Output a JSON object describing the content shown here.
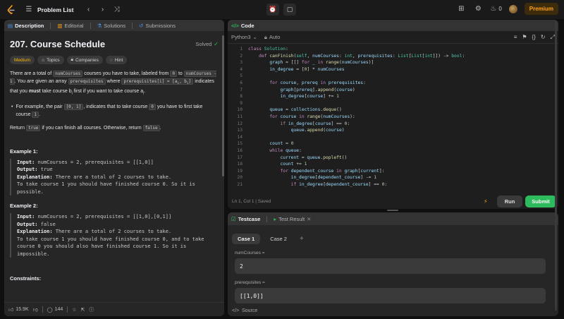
{
  "topbar": {
    "problem_list": "Problem List",
    "streak": "0",
    "premium": "Premium"
  },
  "left_tabs": [
    "Description",
    "Editorial",
    "Solutions",
    "Submissions"
  ],
  "problem": {
    "title": "207. Course Schedule",
    "status": "Solved",
    "difficulty": "Medium",
    "pills": [
      "Topics",
      "Companies",
      "Hint"
    ],
    "p1_a": "There are a total of",
    "p1_code1": "numCourses",
    "p1_b": "courses you have to take, labeled from",
    "p1_code2": "0",
    "p1_c": "to",
    "p1_code3": "numCourses - 1",
    "p1_d": ". You are given an array",
    "p1_code4": "prerequisites",
    "p1_e": "where",
    "p1_code5": "prerequisites[i] = [a",
    "p1_code5b": "i",
    "p1_code5c": ", b",
    "p1_code5d": "i",
    "p1_code5e": "]",
    "p1_f": "indicates that you",
    "p1_must": "must",
    "p1_g": "take course b",
    "p1_sub1": "i",
    "p1_h": "first if you want to take course a",
    "p1_sub2": "i",
    "p1_i": ".",
    "bullet_a": "For example, the pair",
    "bullet_code1": "[0, 1]",
    "bullet_b": ", indicates that to take course",
    "bullet_code2": "0",
    "bullet_c": "you have to first take course",
    "bullet_code3": "1",
    "bullet_d": ".",
    "ret_a": "Return",
    "ret_code1": "true",
    "ret_b": "if you can finish all courses. Otherwise, return",
    "ret_code2": "false",
    "ret_c": ".",
    "ex1_title": "Example 1:",
    "ex1_input_lbl": "Input:",
    "ex1_input": " numCourses = 2, prerequisites = [[1,0]]",
    "ex1_output_lbl": "Output:",
    "ex1_output": " true",
    "ex1_expl_lbl": "Explanation:",
    "ex1_expl": " There are a total of 2 courses to take.\nTo take course 1 you should have finished course 0. So it is possible.",
    "ex2_title": "Example 2:",
    "ex2_input_lbl": "Input:",
    "ex2_input": " numCourses = 2, prerequisites = [[1,0],[0,1]]",
    "ex2_output_lbl": "Output:",
    "ex2_output": " false",
    "ex2_expl_lbl": "Explanation:",
    "ex2_expl": " There are a total of 2 courses to take.\nTo take course 1 you should have finished course 0, and to take course 0 you should also have finished course 1. So it is impossible.",
    "constraints_title": "Constraints:"
  },
  "left_footer": {
    "likes": "15.9K",
    "comments": "144"
  },
  "code_panel": {
    "tab": "Code",
    "language": "Python3",
    "mode": "Auto",
    "status": "Ln 1, Col 1  |  Saved",
    "run": "Run",
    "submit": "Submit",
    "lines": [
      {
        "n": "1",
        "t": "class Solution:"
      },
      {
        "n": "2",
        "t": "    def canFinish(self, numCourses: int, prerequisites: List[List[int]]) -> bool:"
      },
      {
        "n": "3",
        "t": "        graph = [[] for _ in range(numCourses)]"
      },
      {
        "n": "4",
        "t": "        in_degree = [0] * numCourses"
      },
      {
        "n": "5",
        "t": ""
      },
      {
        "n": "6",
        "t": "        for course, prereq in prerequisites:"
      },
      {
        "n": "7",
        "t": "            graph[prereq].append(course)"
      },
      {
        "n": "8",
        "t": "            in_degree[course] += 1"
      },
      {
        "n": "9",
        "t": ""
      },
      {
        "n": "10",
        "t": "        queue = collections.deque()"
      },
      {
        "n": "11",
        "t": "        for course in range(numCourses):"
      },
      {
        "n": "12",
        "t": "            if in_degree[course] == 0:"
      },
      {
        "n": "13",
        "t": "                queue.append(course)"
      },
      {
        "n": "14",
        "t": ""
      },
      {
        "n": "15",
        "t": "        count = 0"
      },
      {
        "n": "16",
        "t": "        while queue:"
      },
      {
        "n": "17",
        "t": "            current = queue.popleft()"
      },
      {
        "n": "18",
        "t": "            count += 1"
      },
      {
        "n": "19",
        "t": "            for dependent_course in graph[current]:"
      },
      {
        "n": "20",
        "t": "                in_degree[dependent_course] -= 1"
      },
      {
        "n": "21",
        "t": "                if in_degree[dependent_course] == 0:"
      }
    ]
  },
  "test_panel": {
    "tab_testcase": "Testcase",
    "tab_result": "Test Result",
    "case1": "Case 1",
    "case2": "Case 2",
    "label1": "numCourses =",
    "value1": "2",
    "label2": "prerequisites =",
    "value2": "[[1,0]]",
    "source": "Source"
  },
  "colors": {
    "accent": "#ffa116",
    "submit": "#2cbb5d",
    "medium": "#ffb800"
  }
}
